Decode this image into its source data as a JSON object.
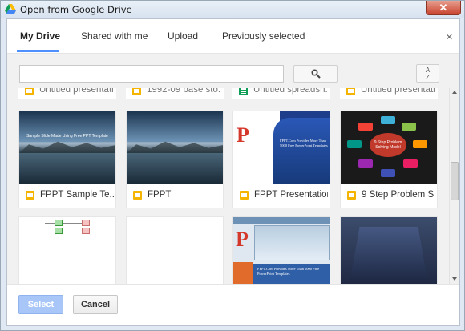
{
  "window": {
    "title": "Open from Google Drive",
    "close_glyph": "✕"
  },
  "tabs": [
    {
      "label": "My Drive",
      "active": true
    },
    {
      "label": "Shared with me",
      "active": false
    },
    {
      "label": "Upload",
      "active": false
    },
    {
      "label": "Previously selected",
      "active": false
    }
  ],
  "dialog_close_glyph": "×",
  "toolbar": {
    "search_value": "",
    "search_placeholder": "",
    "search_icon": "search-icon",
    "sort_icon": "sort-az-icon",
    "sort_glyph_top": "A",
    "sort_glyph_bottom": "Z"
  },
  "files_partial_row": [
    {
      "title": "Untitled presentati...",
      "type": "slides"
    },
    {
      "title": "1992-09 base sto...",
      "type": "slides"
    },
    {
      "title": "Untitled spreadsh...",
      "type": "sheets"
    },
    {
      "title": "Untitled presentati...",
      "type": "slides"
    }
  ],
  "files_row_1": [
    {
      "title": "FPPT Sample Te...",
      "type": "slides",
      "thumb_caption": "Sample Slide Made Using Free PPT Template"
    },
    {
      "title": "FPPT",
      "type": "slides"
    },
    {
      "title": "FPPT Presentation...",
      "type": "slides",
      "thumb_caption": "FPPT.Com Provides More Than 5000 Free PowerPoint Templates"
    },
    {
      "title": "9 Step Problem S...",
      "type": "slides",
      "thumb_caption": "9 Step Problem Solving Model"
    }
  ],
  "files_row_2": [
    {
      "title": "",
      "type": "slides"
    },
    {
      "title": "",
      "type": "slides"
    },
    {
      "title": "",
      "type": "slides",
      "thumb_caption": "FPPT.Com Provides More Than 5000 Free PowerPoint Templates"
    },
    {
      "title": "",
      "type": "slides"
    }
  ],
  "footer": {
    "select_label": "Select",
    "cancel_label": "Cancel"
  },
  "colors": {
    "accent": "#4d90fe",
    "slides_yellow": "#f4b400",
    "sheets_green": "#0f9d58",
    "select_disabled": "#a8c7f8"
  }
}
